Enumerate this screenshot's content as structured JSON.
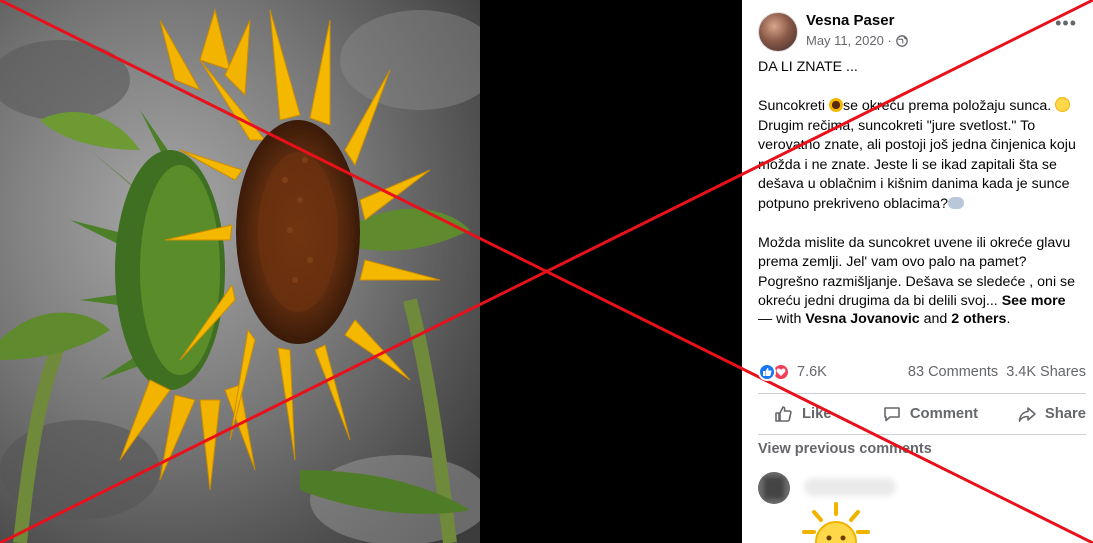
{
  "post": {
    "author": "Vesna Paser",
    "date": "May 11, 2020 ·",
    "privacy_icon": "globe-icon",
    "text": {
      "title": "DA LI ZNATE ...",
      "p1_a": "Suncokreti ",
      "p1_b": "se okreću prema položaju sunca. ",
      "p1_c": " Drugim rečima, suncokreti \"jure svetlost.\" To verovatno znate, ali postoji još jedna činjenica koju možda i ne znate. Jeste li se ikad zapitali šta se dešava u oblačnim i kišnim danima kada je sunce potpuno prekriveno oblacima?",
      "p2": "Možda mislite da suncokret uvene ili okreće glavu prema zemlji. Jel' vam ovo palo na pamet? Pogrešno razmišljanje. Dešava se sledeće , oni se okreću jedni drugima da bi delili svoj...",
      "see_more": "See more"
    },
    "with": {
      "prefix": "— with ",
      "person": "Vesna Jovanovic",
      "and": " and ",
      "others": "2 others",
      "suffix": "."
    },
    "reactions": {
      "count": "7.6K",
      "comments": "83 Comments",
      "shares": "3.4K Shares"
    },
    "actions": {
      "like": "Like",
      "comment": "Comment",
      "share": "Share"
    },
    "view_previous": "View previous comments"
  },
  "colors": {
    "accent_blue": "#1877f2",
    "love_red": "#f33e58",
    "cross_red": "#e8111b",
    "muted_text": "#65676b"
  }
}
